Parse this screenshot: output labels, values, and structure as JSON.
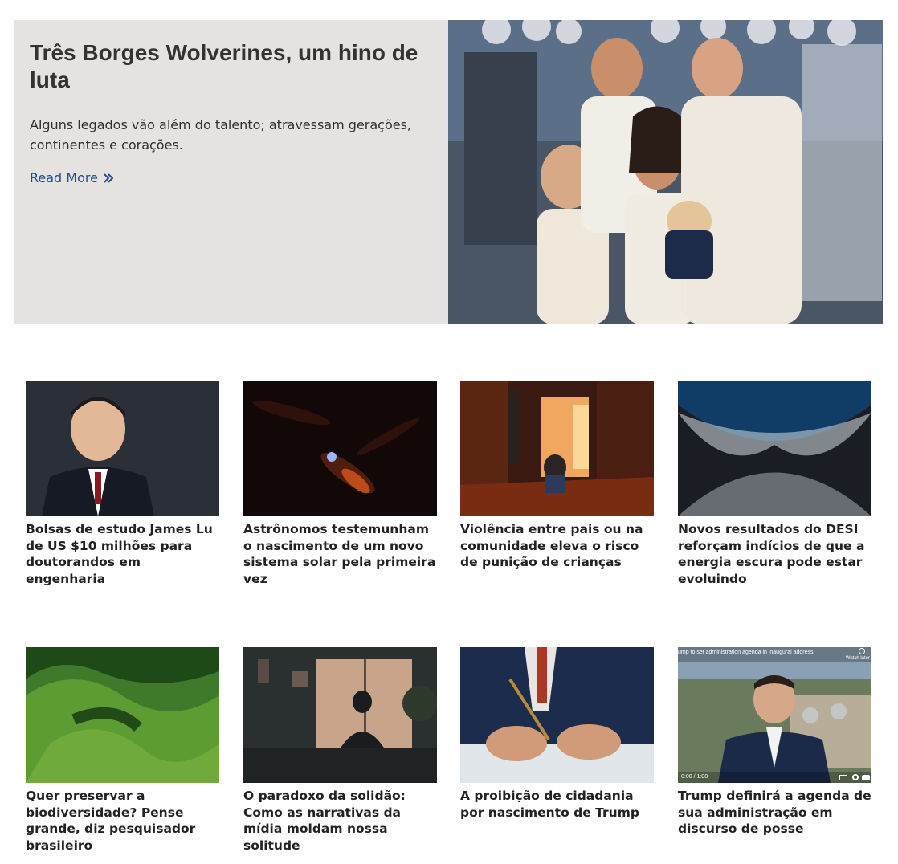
{
  "hero": {
    "title": "Três Borges Wolverines, um hino de luta",
    "description": "Alguns legados vão além do talento; atravessam gerações, continentes e corações.",
    "read_more": "Read More",
    "image_icon": "family-photo"
  },
  "articles": [
    {
      "title": "Bolsas de estudo James Lu de US $10 milhões para doutorandos em engenharia",
      "image_icon": "portrait-photo"
    },
    {
      "title": "Astrônomos testemunham o nascimento de um novo sistema solar pela primeira vez",
      "image_icon": "space-photo"
    },
    {
      "title": "Violência entre pais ou na comunidade eleva o risco de punição de crianças",
      "image_icon": "illustration"
    },
    {
      "title": "Novos resultados do DESI reforçam indícios de que a energia escura pode estar evoluindo",
      "image_icon": "cosmic-web-photo"
    },
    {
      "title": "Quer preservar a biodiversidade? Pense grande, diz pesquisador brasileiro",
      "image_icon": "landscape-photo"
    },
    {
      "title": "O paradoxo da solidão: Como as narrativas da mídia moldam nossa solitude",
      "image_icon": "illustration"
    },
    {
      "title": "A proibição de cidadania por nascimento de Trump",
      "image_icon": "signing-photo"
    },
    {
      "title": "Trump definirá a agenda de sua administração em discurso de posse",
      "image_icon": "video-thumbnail"
    }
  ],
  "video": {
    "headline": "ump to set administration agenda in inaugural address",
    "watch_label": "Watch later",
    "time": "0:00 / 1:08"
  },
  "colors": {
    "hero_bg": "#e6e2df",
    "link": "#1f4c8c"
  }
}
